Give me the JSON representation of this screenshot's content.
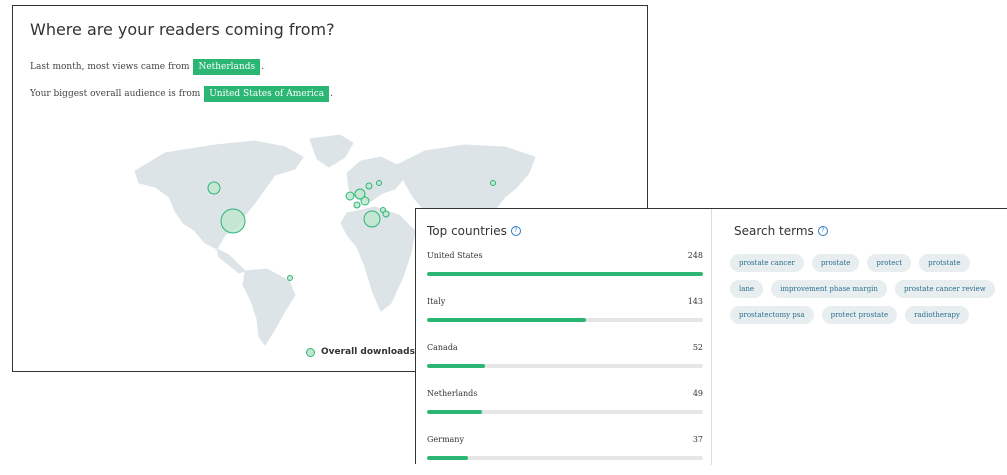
{
  "readers": {
    "title": "Where are your readers coming from?",
    "line1_prefix": "Last month, most views came from",
    "line1_highlight": "Netherlands",
    "line1_suffix": ".",
    "line2_prefix": "Your biggest overall audience is from",
    "line2_highlight": "United States of America",
    "line2_suffix": ".",
    "legend_label": "Overall downloads",
    "colors": {
      "highlight": "#2bb673",
      "land": "#dde4e8",
      "bubble_fill": "#bfe6cf"
    }
  },
  "top_countries": {
    "title": "Top countries",
    "help_icon": "help-circle-icon",
    "max": 248,
    "items": [
      {
        "name": "United States",
        "count": 248
      },
      {
        "name": "Italy",
        "count": 143
      },
      {
        "name": "Canada",
        "count": 52
      },
      {
        "name": "Netherlands",
        "count": 49
      },
      {
        "name": "Germany",
        "count": 37
      }
    ]
  },
  "search_terms": {
    "title": "Search terms",
    "help_icon": "help-circle-icon",
    "tags": [
      "prostate cancer",
      "prostate",
      "protect",
      "protstate",
      "lane",
      "improvement phase margin",
      "prostate cancer review",
      "prostatectomy psa",
      "protect prostate",
      "radiotherapy"
    ]
  }
}
